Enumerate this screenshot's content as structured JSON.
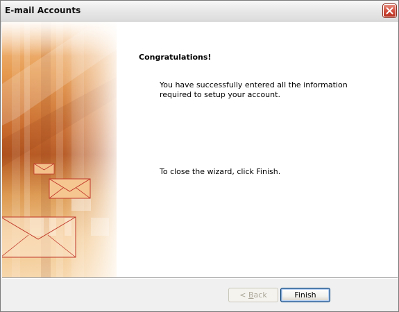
{
  "window": {
    "title": "E-mail Accounts"
  },
  "content": {
    "heading": "Congratulations!",
    "success_message": "You have successfully entered all the information required to setup your account.",
    "close_instruction": "To close the wizard, click Finish."
  },
  "buttons": {
    "back_prefix": "< ",
    "back_mnemonic": "B",
    "back_rest": "ack",
    "finish": "Finish"
  },
  "colors": {
    "accent": "#f7941d",
    "title_close": "#cf4a3b",
    "focus_border": "#003c74"
  },
  "icons": {
    "close": "close-icon",
    "envelopes": "envelope-icon"
  }
}
